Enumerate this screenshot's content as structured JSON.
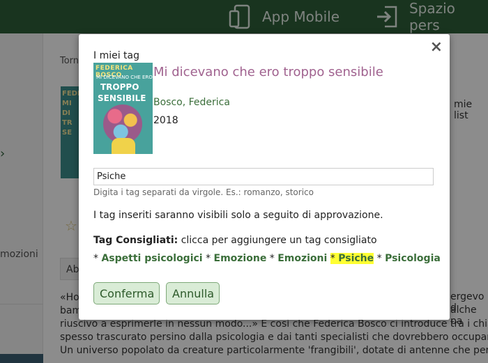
{
  "header": {
    "app_mobile_label": "App Mobile",
    "personal_space_label": "Spazio pers"
  },
  "background": {
    "back_link": "Torn",
    "cover_text": "FEDE MI DI TR SE",
    "my_lists": "mie list",
    "sidebar_text": "mozioni",
    "tab_label": "Ab",
    "description_lines": [
      "«Ho",
      "bam",
      "riuscivo a esprimerle in nessun modo...» È così che Federica Bosco ci introduce tra i chiar",
      "spesso trascurato persino dalla psicologia e dai tanti specialisti che dovrebbero occupars",
      "Un universo popolato da creature particolarmente 'frangibili', dotate di antenne che perc"
    ],
    "description_right_1": "ergevo d",
    "description_right_2": "alche pa"
  },
  "modal": {
    "title": "I miei tag",
    "close_glyph": "×",
    "book": {
      "title": "Mi dicevano che ero troppo sensibile",
      "author": "Bosco, Federica",
      "year": "2018",
      "cover_author": "FEDERICA BOSCO",
      "cover_line1": "MI DICEVANO CHE ERO",
      "cover_line2": "TROPPO",
      "cover_line3": "SENSIBILE"
    },
    "tag_input_value": "Psiche",
    "hint": "Digita i tag separati da virgole. Es.: romanzo, storico",
    "approval_notice": "I tag inseriti saranno visibili solo a seguito di approvazione.",
    "suggested_label": "Tag Consigliati:",
    "suggested_instruction": " clicca per aggiungere un tag consigliato",
    "separator": "*",
    "suggested_tags": [
      "Aspetti psicologici",
      "Emozione",
      "Emozioni",
      "Psiche",
      "Psicologia"
    ],
    "selected_tag": "Psiche",
    "confirm_label": "Conferma",
    "cancel_label": "Annulla"
  },
  "colors": {
    "header": "#2f5f3a",
    "title": "#a0628f",
    "link_green": "#3b6e3a",
    "highlight": "#ffff33",
    "button_bg": "#d9ecd6"
  }
}
